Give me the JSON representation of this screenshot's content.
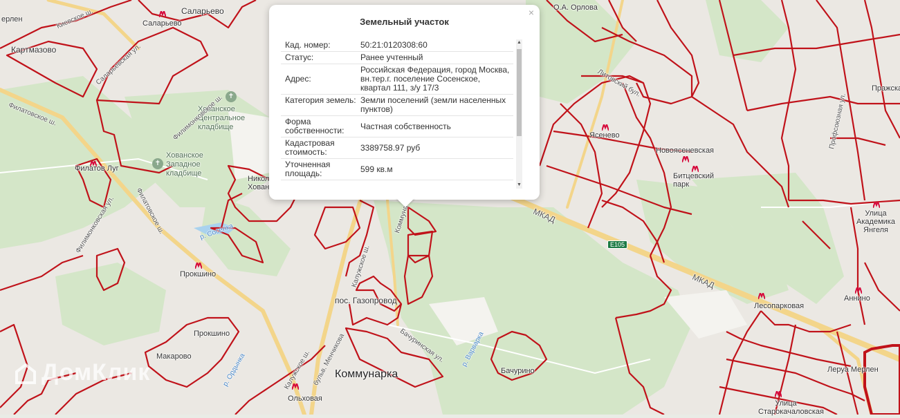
{
  "popup": {
    "title": "Земельный участок",
    "close_label": "×",
    "rows": [
      {
        "key": "Кад. номер:",
        "value": "50:21:0120308:60"
      },
      {
        "key": "Статус:",
        "value": "Ранее учтенный"
      },
      {
        "key": "Адрес:",
        "value": "Российская Федерация, город Москва, вн.тер.г. поселение Сосенское, квартал 111, з/у 17/3"
      },
      {
        "key": "Категория земель:",
        "value": "Земли поселений (земли населенных пунктов)"
      },
      {
        "key": "Форма собственности:",
        "value": "Частная собственность"
      },
      {
        "key": "Кадастровая стоимость:",
        "value": "3389758.97 руб"
      },
      {
        "key": "Уточненная площадь:",
        "value": "599 кв.м"
      }
    ]
  },
  "map": {
    "places": {
      "salaryevo": "Саларьево",
      "salaryevo_metro": "Саларьево",
      "kartmazovo": "Картмазово",
      "filatov_lug": "Филатов Луг",
      "prokshino_metro": "Прокшино",
      "prokshino": "Прокшино",
      "makarovo": "Макарово",
      "gazoprovod": "пос. Газопровод",
      "kommunarka": "Коммунарка",
      "olkhovaya": "Ольховая",
      "bachurino": "Бачурино",
      "yasenevo": "Ясенево",
      "novoyasenevskaya": "Новоясеневская",
      "bitsevsky_park": "Битцевский парк",
      "lesoparkovaya": "Лесопарковая",
      "annino": "Аннино",
      "akademika_yangelya": "Улица Академика Янгеля",
      "prazhskaya": "Пражская",
      "starokachalovskaya": "Улица Старокачаловская",
      "lerya_merlen": "Леруа Мерлен",
      "nikol_hovan": "Никол Хован",
      "orlova": "О.А. Орлова",
      "merlen_left": "ерлен"
    },
    "greens": {
      "khovanskoe_central": "Хованское Центральное кладбище",
      "khovanskoe_west": "Хованское Западное кладбище"
    },
    "roads": {
      "kievskoe": "Киевское ш.",
      "salaryevskaya": "Саларьевская ул.",
      "filatovskoe1": "Филатовское ш.",
      "filatovskoe2": "Филатовское ш.",
      "filimonkovskoe1": "Филимонковское ш.",
      "filimonkovskaya": "Филимонковская ул.",
      "kaluzhskoe1": "Калужское ш.",
      "kaluzhskoe2": "Калужское ш.",
      "mkad1": "МКАД",
      "mkad2": "МКАД",
      "menchikova": "бульв. Менчикова",
      "varvarka": "р. Варварка",
      "ordynka": "р. Ордынка",
      "sosenka": "р. Сосенка",
      "litovsky": "Литовский бул.",
      "bachurinskaya": "Бачуринская ул.",
      "kommunarka_road": "Коммуна",
      "profsoyuznaya": "Профсоюзная ул."
    },
    "route_badge": "E105",
    "watermark": "ДомКлик"
  },
  "colors": {
    "boundary": "#c0121a",
    "green": "#cfe3c4",
    "road_yellow": "#f3d58a",
    "urban": "#e9e6e1"
  }
}
